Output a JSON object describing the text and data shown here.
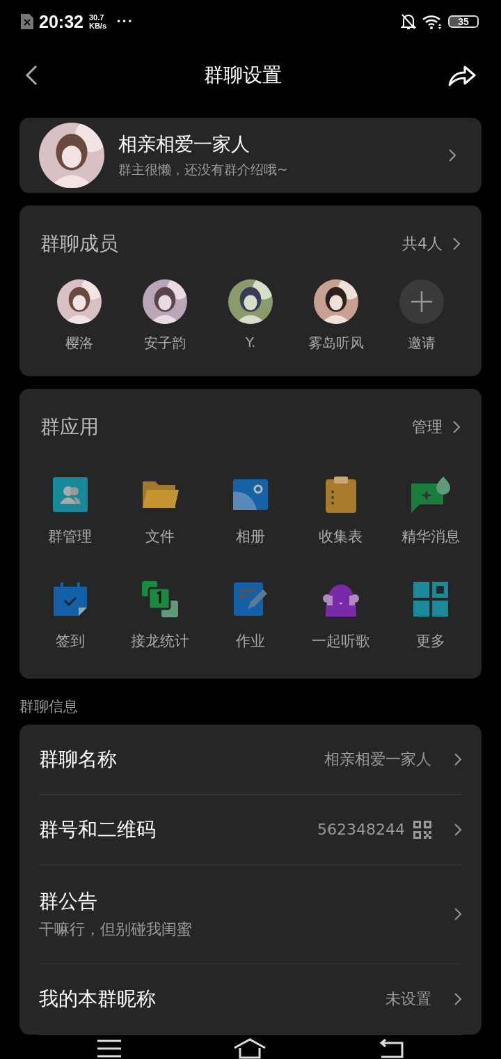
{
  "status_bar": {
    "time": "20:32",
    "speed_value": "30.7",
    "speed_unit": "KB/s",
    "dots": "•••",
    "battery": "35"
  },
  "header": {
    "title": "群聊设置"
  },
  "group": {
    "name": "相亲相爱一家人",
    "intro": "群主很懒，还没有群介绍哦~"
  },
  "members": {
    "title": "群聊成员",
    "count": "共4人",
    "items": [
      {
        "kind": "picture",
        "name": "樱洛"
      },
      {
        "kind": "picture",
        "name": "安子韵"
      },
      {
        "kind": "picture",
        "name": "Y."
      },
      {
        "kind": "picture",
        "name": "雾岛听风"
      },
      {
        "kind": "invite",
        "name": "邀请"
      }
    ]
  },
  "apps": {
    "title": "群应用",
    "action": "管理",
    "items": [
      {
        "label": "群管理"
      },
      {
        "label": "文件"
      },
      {
        "label": "相册"
      },
      {
        "label": "收集表"
      },
      {
        "label": "精华消息"
      },
      {
        "label": "签到"
      },
      {
        "label": "接龙统计"
      },
      {
        "label": "作业"
      },
      {
        "label": "一起听歌"
      },
      {
        "label": "更多"
      }
    ]
  },
  "info": {
    "section_title": "群聊信息",
    "rows": [
      {
        "kind": "value",
        "label": "群聊名称",
        "value": "相亲相爱一家人"
      },
      {
        "kind": "qr",
        "label": "群号和二维码",
        "value": "562348244"
      },
      {
        "kind": "note",
        "label": "群公告",
        "note": "干嘛行，但别碰我闺蜜"
      },
      {
        "kind": "value",
        "label": "我的本群昵称",
        "value": "未设置"
      }
    ]
  }
}
